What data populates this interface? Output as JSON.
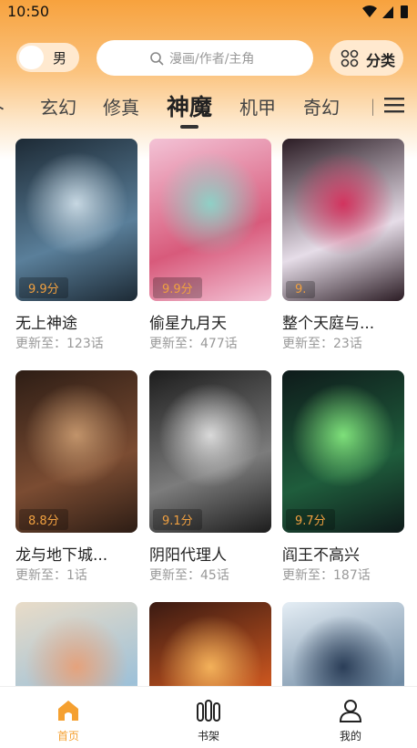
{
  "status_bar": {
    "time": "10:50"
  },
  "header": {
    "gender_label": "男",
    "search_placeholder": "漫画/作者/主角",
    "category_label": "分类"
  },
  "tabs": [
    {
      "label": "玄幻",
      "active": false
    },
    {
      "label": "修真",
      "active": false
    },
    {
      "label": "神魔",
      "active": true
    },
    {
      "label": "机甲",
      "active": false
    },
    {
      "label": "奇幻",
      "active": false
    }
  ],
  "comics": [
    {
      "title": "无上神途",
      "score": "9.9分",
      "update": "更新至：123话",
      "cover_colors": [
        "#1d2a35",
        "#5a7f9a",
        "#c6d7e2"
      ]
    },
    {
      "title": "偷星九月天",
      "score": "9.9分",
      "update": "更新至：477话",
      "cover_colors": [
        "#f3c3d6",
        "#d85a7b",
        "#8fd0c6"
      ]
    },
    {
      "title": "整个天庭与我为敌",
      "score": "9.",
      "update": "更新至：23话",
      "cover_colors": [
        "#2b1c24",
        "#e6dde8",
        "#d2335e"
      ]
    },
    {
      "title": "龙与地下城世界",
      "score": "8.8分",
      "update": "更新至：1话",
      "cover_colors": [
        "#2d1d15",
        "#7b4c32",
        "#c1936a"
      ]
    },
    {
      "title": "阴阳代理人",
      "score": "9.1分",
      "update": "更新至：45话",
      "cover_colors": [
        "#1c1c1c",
        "#7c7c7c",
        "#d9d9d9"
      ]
    },
    {
      "title": "阎王不高兴",
      "score": "9.7分",
      "update": "更新至：187话",
      "cover_colors": [
        "#0e1a1a",
        "#1f5d3c",
        "#7ee07a"
      ]
    },
    {
      "title": "",
      "score": "",
      "update": "",
      "cover_colors": [
        "#e9dcc8",
        "#9ec1d8",
        "#e5a27c"
      ]
    },
    {
      "title": "",
      "score": "",
      "update": "",
      "cover_colors": [
        "#3a1a12",
        "#c8551f",
        "#f3b15a"
      ]
    },
    {
      "title": "",
      "score": "",
      "update": "",
      "cover_colors": [
        "#e5eef5",
        "#6f8aa3",
        "#2b3e58"
      ]
    }
  ],
  "bottom_nav": [
    {
      "label": "首页",
      "icon": "home-icon",
      "active": true
    },
    {
      "label": "书架",
      "icon": "bookshelf-icon",
      "active": false
    },
    {
      "label": "我的",
      "icon": "profile-icon",
      "active": false
    }
  ],
  "colors": {
    "accent": "#f5a030",
    "header_top": "#f7a23e"
  }
}
